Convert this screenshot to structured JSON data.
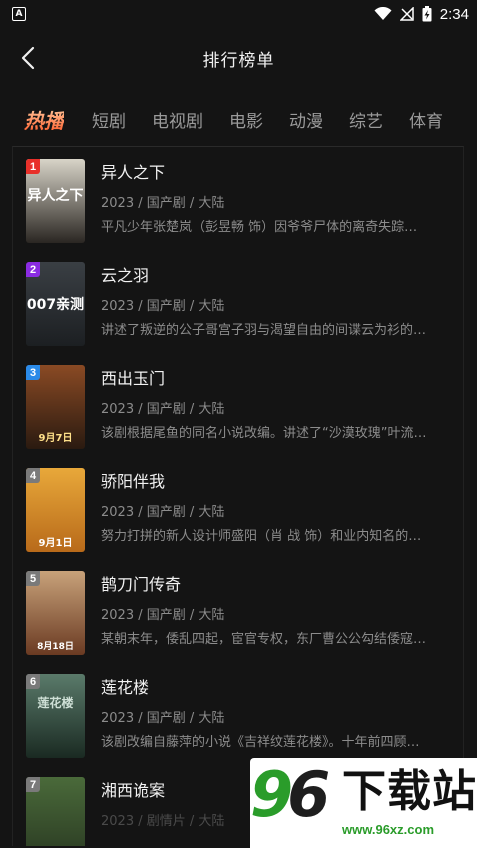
{
  "status_bar": {
    "left_icon": "A",
    "time": "2:34",
    "icons": [
      "wifi-icon",
      "signal-off-icon",
      "battery-charging-icon"
    ]
  },
  "header": {
    "title": "排行榜单",
    "back_icon": "chevron-left-icon"
  },
  "tabs": [
    {
      "label": "热播",
      "active": true
    },
    {
      "label": "短剧",
      "active": false
    },
    {
      "label": "电视剧",
      "active": false
    },
    {
      "label": "电影",
      "active": false
    },
    {
      "label": "动漫",
      "active": false
    },
    {
      "label": "综艺",
      "active": false
    },
    {
      "label": "体育",
      "active": false
    }
  ],
  "items": [
    {
      "rank": "1",
      "rank_color": "#e8302a",
      "title": "异人之下",
      "meta": "2023 / 国产剧 / 大陆",
      "desc": "平凡少年张楚岚（彭昱畅 饰）因爷爷尸体的离奇失踪…",
      "poster_text": "异人之下",
      "poster_colors": [
        "#d8d4c8",
        "#2a2622"
      ]
    },
    {
      "rank": "2",
      "rank_color": "#8a2be2",
      "title": "云之羽",
      "meta": "2023 / 国产剧 / 大陆",
      "desc": "讲述了叛逆的公子哥宫子羽与渴望自由的间谍云为衫的…",
      "poster_text": "007亲测",
      "poster_colors": [
        "#3a3f44",
        "#1c1f22"
      ]
    },
    {
      "rank": "3",
      "rank_color": "#2a8ae8",
      "title": "西出玉门",
      "meta": "2023 / 国产剧 / 大陆",
      "desc": "该剧根据尾鱼的同名小说改编。讲述了“沙漠玫瑰”叶流…",
      "poster_text": "9月7日",
      "poster_colors": [
        "#8a4a24",
        "#2a1a10"
      ]
    },
    {
      "rank": "4",
      "rank_color": "#7a7a7a",
      "title": "骄阳伴我",
      "meta": "2023 / 国产剧 / 大陆",
      "desc": "努力打拼的新人设计师盛阳（肖 战 饰）和业内知名的…",
      "poster_text": "9月1日",
      "poster_colors": [
        "#e8a83a",
        "#b86a1a"
      ]
    },
    {
      "rank": "5",
      "rank_color": "#7a7a7a",
      "title": "鹊刀门传奇",
      "meta": "2023 / 国产剧 / 大陆",
      "desc": "某朝末年，倭乱四起，宦官专权，东厂曹公公勾结倭寇…",
      "poster_text": "8月18日",
      "poster_colors": [
        "#c8a27a",
        "#6a3a22"
      ]
    },
    {
      "rank": "6",
      "rank_color": "#7a7a7a",
      "title": "莲花楼",
      "meta": "2023 / 国产剧 / 大陆",
      "desc": "该剧改编自藤萍的小说《吉祥纹莲花楼》。十年前四顾…",
      "poster_text": "莲花楼",
      "poster_colors": [
        "#5a7a6a",
        "#1a2a22"
      ]
    },
    {
      "rank": "7",
      "rank_color": "#7a7a7a",
      "title": "湘西诡案",
      "meta": "2023 / 剧情片 / 大陆",
      "desc": "",
      "poster_text": "",
      "poster_colors": [
        "#4a6a3a",
        "#2a3a22"
      ]
    }
  ],
  "watermark": {
    "number": "96",
    "text": "下载站",
    "url": "www.96xz.com"
  }
}
